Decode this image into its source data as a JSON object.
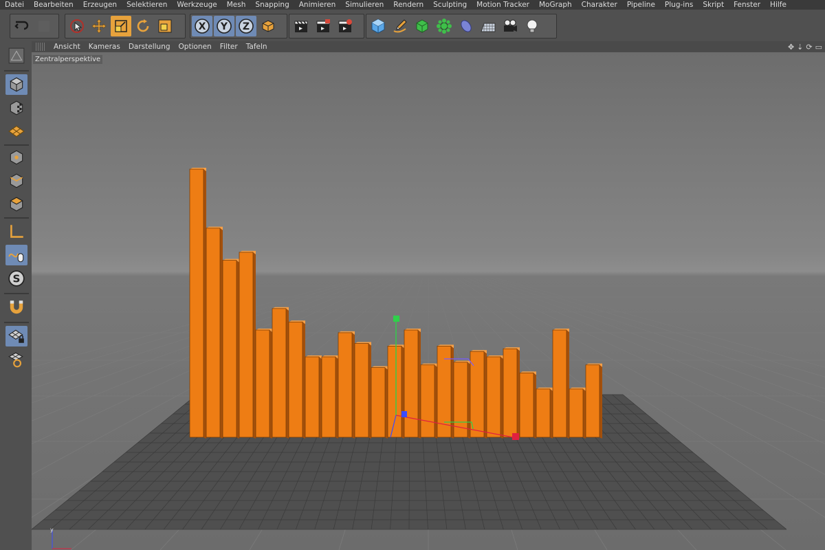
{
  "menu": [
    "Datei",
    "Bearbeiten",
    "Erzeugen",
    "Selektieren",
    "Werkzeuge",
    "Mesh",
    "Snapping",
    "Animieren",
    "Simulieren",
    "Rendern",
    "Sculpting",
    "Motion Tracker",
    "MoGraph",
    "Charakter",
    "Pipeline",
    "Plug-ins",
    "Skript",
    "Fenster",
    "Hilfe"
  ],
  "axis_buttons": [
    "X",
    "Y",
    "Z"
  ],
  "viewport_menu": [
    "Ansicht",
    "Kameras",
    "Darstellung",
    "Optionen",
    "Filter",
    "Tafeln"
  ],
  "viewport_label": "Zentralperspektive",
  "colors": {
    "bar_front": "#ee7d14",
    "bar_side": "#a4500b",
    "bar_top": "#f7a047",
    "floor": "#4f4f4f",
    "accent": "#e7a23c"
  },
  "scene": {
    "bar_heights": [
      1.0,
      0.78,
      0.66,
      0.69,
      0.4,
      0.48,
      0.43,
      0.3,
      0.3,
      0.39,
      0.35,
      0.26,
      0.34,
      0.4,
      0.27,
      0.34,
      0.28,
      0.32,
      0.3,
      0.33,
      0.24,
      0.18,
      0.4,
      0.18,
      0.27
    ]
  }
}
